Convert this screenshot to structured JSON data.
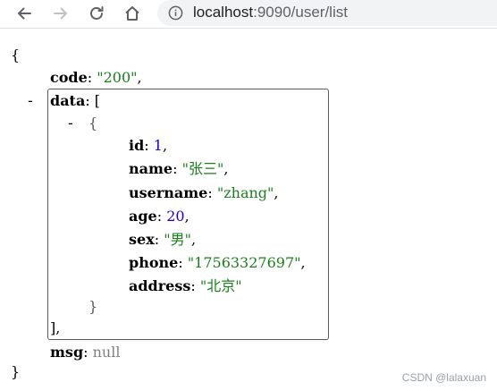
{
  "browser": {
    "url_host": "localhost",
    "url_rest": ":9090/user/list"
  },
  "json": {
    "open_brace": "{",
    "close_brace": "}",
    "code_key": "code",
    "code_value": "\"200\"",
    "data_toggle": "-",
    "data_key": "data",
    "open_bracket": "[",
    "item_toggle": "-",
    "item_open": "{",
    "item_close": "}",
    "close_bracket": "],",
    "fields": [
      {
        "key": "id",
        "value": "1"
      },
      {
        "key": "name",
        "value": "\"张三\""
      },
      {
        "key": "username",
        "value": "\"zhang\""
      },
      {
        "key": "age",
        "value": "20"
      },
      {
        "key": "sex",
        "value": "\"男\""
      },
      {
        "key": "phone",
        "value": "\"17563327697\""
      },
      {
        "key": "address",
        "value": "\"北京\""
      }
    ],
    "msg_key": "msg",
    "msg_value": "null"
  },
  "watermark": "CSDN @lalaxuan"
}
